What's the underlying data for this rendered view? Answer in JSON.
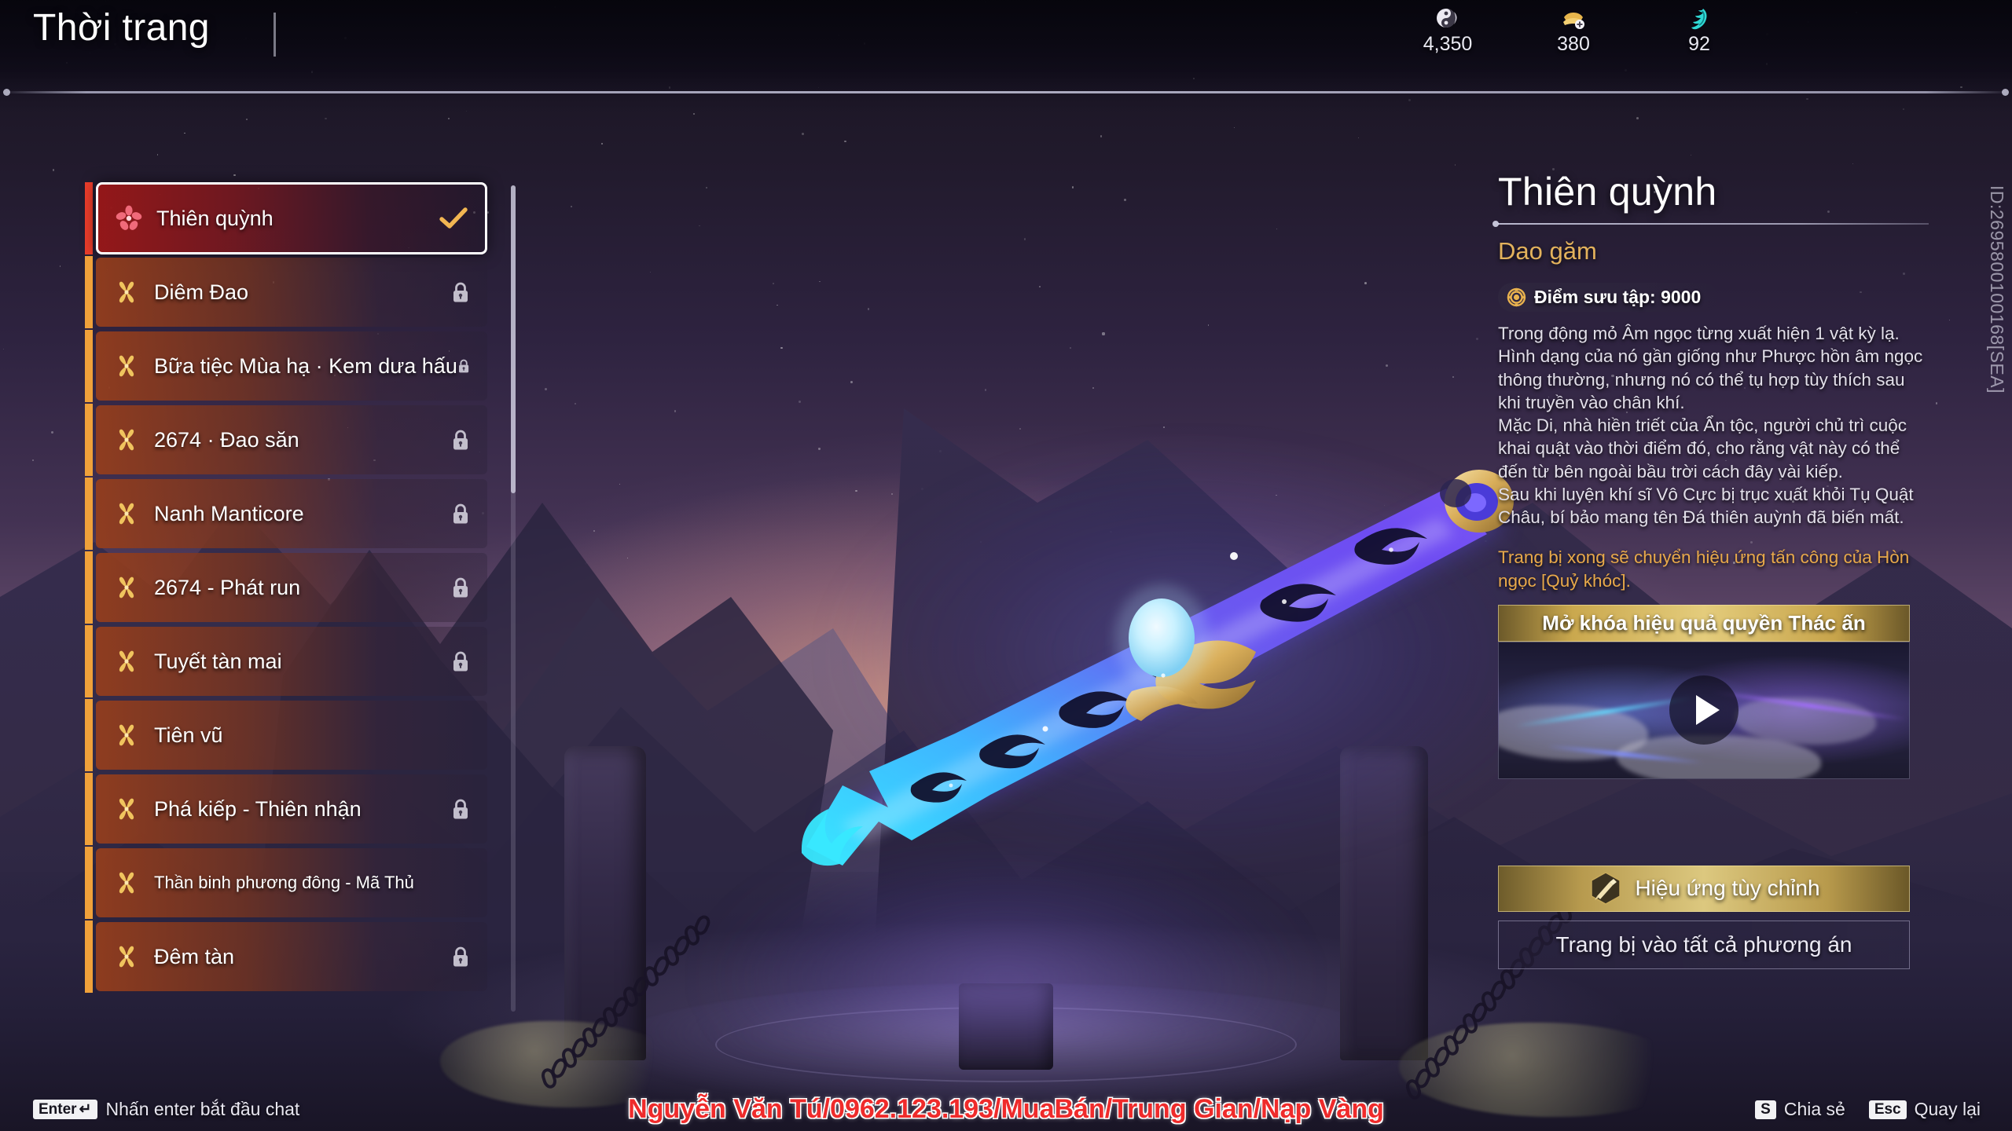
{
  "header": {
    "title": "Thời trang",
    "currencies": [
      {
        "icon": "yinyang-coin-icon",
        "value": "4,350"
      },
      {
        "icon": "gold-ingot-icon",
        "value": "380"
      },
      {
        "icon": "conch-shell-icon",
        "value": "92"
      }
    ]
  },
  "list": {
    "items": [
      {
        "label": "Thiên quỳnh",
        "selected": true,
        "locked": false,
        "icon": "flower-star-icon"
      },
      {
        "label": "Diêm Đao",
        "selected": false,
        "locked": true,
        "icon": "petal-cross-icon"
      },
      {
        "label": "Bữa tiệc Mùa hạ · Kem dưa hấu",
        "selected": false,
        "locked": true,
        "icon": "petal-cross-icon"
      },
      {
        "label": "2674 · Đao săn",
        "selected": false,
        "locked": true,
        "icon": "petal-cross-icon"
      },
      {
        "label": "Nanh Manticore",
        "selected": false,
        "locked": true,
        "icon": "petal-cross-icon"
      },
      {
        "label": "2674 - Phát run",
        "selected": false,
        "locked": true,
        "icon": "petal-cross-icon"
      },
      {
        "label": "Tuyết tàn mai",
        "selected": false,
        "locked": true,
        "icon": "petal-cross-icon"
      },
      {
        "label": "Tiên vũ",
        "selected": false,
        "locked": false,
        "icon": "petal-cross-icon"
      },
      {
        "label": "Phá kiếp - Thiên nhận",
        "selected": false,
        "locked": true,
        "icon": "petal-cross-icon"
      },
      {
        "label": "Thần binh phương đông - Mã Thủ",
        "selected": false,
        "locked": false,
        "icon": "petal-cross-icon",
        "small": true
      },
      {
        "label": "Đêm tàn",
        "selected": false,
        "locked": true,
        "icon": "petal-cross-icon"
      }
    ]
  },
  "detail": {
    "title": "Thiên quỳnh",
    "subtitle": "Dao găm",
    "collection_points": "Điểm sưu tập: 9000",
    "collection_icon": "collection-gear-icon",
    "description_1": "Trong động mỏ Âm ngọc từng xuất hiện 1 vật kỳ lạ. Hình dạng của nó gần giống như Phược hồn âm ngọc thông thường, nhưng nó có thể tụ hợp tùy thích sau khi truyền vào chân khí.",
    "description_2": "Mặc Di, nhà hiền triết của Ẩn tộc, người chủ trì cuộc khai quật vào thời điểm đó, cho rằng vật này có thể đến từ bên ngoài bầu trời cách đây vài kiếp.",
    "description_3": "Sau khi luyện khí sĩ Vô Cực bị trục xuất khỏi Tụ Quật Châu, bí bảo mang tên Đá thiên auỳnh đã biến mất.",
    "note": "Trang bị xong sẽ chuyển hiệu ứng tấn công của Hòn ngọc [Quỷ khóc].",
    "video_header": "Mở khóa hiệu quả quyền Thác ấn",
    "play_icon": "play-icon",
    "custom_effect_button": "Hiệu ứng tùy chỉnh",
    "custom_effect_icon": "dagger-hex-icon",
    "equip_all_button": "Trang bị vào tất cả phương án",
    "item_id": "ID:2695800100168[SEA]"
  },
  "footer": {
    "chat_key": "Enter",
    "chat_key_glyph": "↵",
    "chat_hint": "Nhấn enter bắt đầu chat",
    "watermark": "Nguyễn Văn Tú/0962.123.193/MuaBán/Trung Gian/Nạp Vàng",
    "share_key": "S",
    "share_label": "Chia sẻ",
    "back_key": "Esc",
    "back_label": "Quay lại"
  },
  "colors": {
    "accent_gold": "#e3b25c",
    "selected_red": "#ec3d2b",
    "item_orange": "#f0a13a",
    "note_orange": "#e8a94a",
    "watermark_red": "#ef2b2b"
  }
}
